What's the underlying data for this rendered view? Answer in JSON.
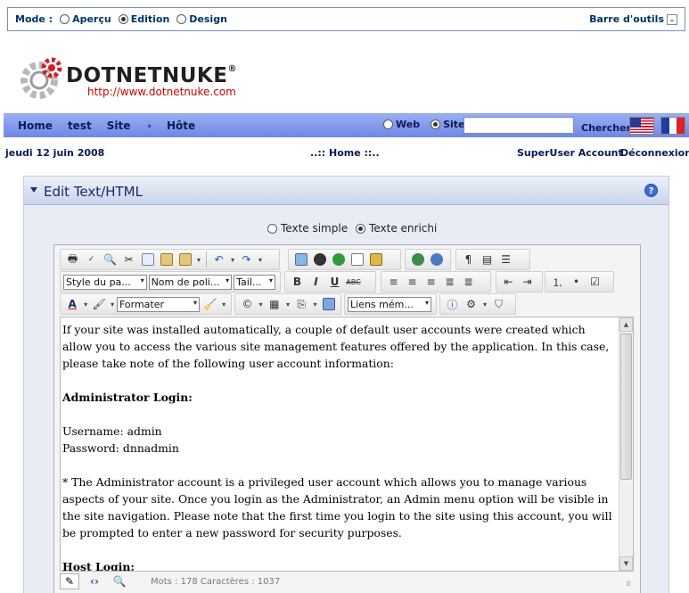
{
  "control_panel": {
    "mode_label": "Mode :",
    "modes": [
      "Aperçu",
      "Edition",
      "Design"
    ],
    "selected_mode": "Edition",
    "toolbar_link": "Barre d'outils",
    "toolbar_arrow": "⌄"
  },
  "logo": {
    "name": "DOTNETNUKE",
    "trademark": "®",
    "url": "http://www.dotnetnuke.com"
  },
  "nav": {
    "items": [
      "Home",
      "test",
      "Site",
      "Hôte"
    ],
    "submenu_arrow": "◆",
    "search_scopes": [
      "Web",
      "Site"
    ],
    "selected_scope": "Site",
    "search_placeholder": "",
    "search_button": "Chercher",
    "languages": [
      "en-US",
      "fr-FR"
    ]
  },
  "info": {
    "date": "jeudi 12 juin 2008",
    "breadcrumb": "..:: Home ::..",
    "user_account": "SuperUser Account",
    "logout": "Déconnexion"
  },
  "module": {
    "title": "Edit Text/HTML",
    "help_icon": "?",
    "editor_modes": [
      "Texte simple",
      "Texte enrichi"
    ],
    "selected_editor_mode": "Texte enrichi",
    "toolbar": {
      "style_select": "Style du pa...",
      "font_select": "Nom de poli...",
      "size_select": "Tail...",
      "format_select": "Formater",
      "links_select": "Liens mém...",
      "bold": "B",
      "italic": "I",
      "underline": "U",
      "strike": "ABC",
      "font_color": "A"
    },
    "content": {
      "intro": "If your site was installed automatically, a couple of default user accounts were created which allow you to access the various site management features offered by the application. In this case, please take note of the following user account information:",
      "admin_heading": "Administrator Login:",
      "admin_username": "Username: admin",
      "admin_password": "Password: dnnadmin",
      "admin_note": "* The Administrator account is a privileged user account which allows you to manage various aspects of your site. Once you login as the Administrator, an Admin menu option will be visible in the site navigation. Please note that the first time you login to the site using this account, you will be prompted to enter a new password for security purposes.",
      "host_heading": "Host Login:"
    },
    "status": {
      "count": "Mots : 178 Caractères : 1037",
      "grip": "⁞⁞⁞"
    }
  },
  "colors": {
    "nav_bar": "#8099ec",
    "text_dark_blue": "#0b1a55",
    "logo_red": "#cc0000",
    "module_bg": "#e8ecf5"
  }
}
